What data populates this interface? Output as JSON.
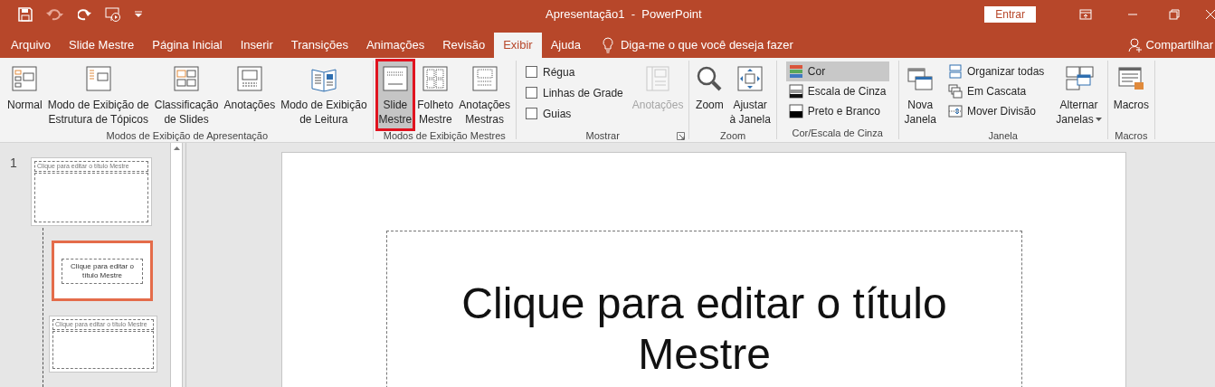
{
  "window": {
    "title": "Apresentação1  -  PowerPoint",
    "sign_in": "Entrar"
  },
  "tabs": [
    {
      "label": "Arquivo",
      "selected": false
    },
    {
      "label": "Slide Mestre",
      "selected": false
    },
    {
      "label": "Página Inicial",
      "selected": false
    },
    {
      "label": "Inserir",
      "selected": false
    },
    {
      "label": "Transições",
      "selected": false
    },
    {
      "label": "Animações",
      "selected": false
    },
    {
      "label": "Revisão",
      "selected": false
    },
    {
      "label": "Exibir",
      "selected": true
    },
    {
      "label": "Ajuda",
      "selected": false
    }
  ],
  "tell_me": "Diga-me o que você deseja fazer",
  "share": "Compartilhar",
  "ribbon": [
    {
      "label": "Modos de Exibição de Apresentação",
      "controls": [
        {
          "kind": "large",
          "lines": [
            "Normal"
          ]
        },
        {
          "kind": "large",
          "lines": [
            "Modo de Exibição de",
            "Estrutura de Tópicos"
          ]
        },
        {
          "kind": "large",
          "lines": [
            "Classificação",
            "de Slides"
          ]
        },
        {
          "kind": "large",
          "lines": [
            "Anotações"
          ]
        },
        {
          "kind": "large",
          "lines": [
            "Modo de Exibição",
            "de Leitura"
          ]
        }
      ]
    },
    {
      "label": "Modos de Exibição Mestres",
      "controls": [
        {
          "kind": "large",
          "lines": [
            "Slide",
            "Mestre"
          ],
          "selected": true
        },
        {
          "kind": "large",
          "lines": [
            "Folheto",
            "Mestre"
          ],
          "selected": false
        },
        {
          "kind": "large",
          "lines": [
            "Anotações",
            "Mestras"
          ],
          "selected": false
        }
      ]
    },
    {
      "label": "Mostrar",
      "launcher": true,
      "controls": [
        {
          "kind": "check",
          "lines": [
            "Régua"
          ],
          "checked": false
        },
        {
          "kind": "check",
          "lines": [
            "Linhas de Grade"
          ],
          "checked": false
        },
        {
          "kind": "check",
          "lines": [
            "Guias"
          ],
          "checked": false
        },
        {
          "kind": "large",
          "lines": [
            "Anotações"
          ],
          "disabled": true
        }
      ]
    },
    {
      "label": "Zoom",
      "controls": [
        {
          "kind": "large",
          "lines": [
            "Zoom"
          ]
        },
        {
          "kind": "large",
          "lines": [
            "Ajustar",
            "à Janela"
          ]
        }
      ]
    },
    {
      "label": "Cor/Escala de Cinza",
      "controls": [
        {
          "kind": "small",
          "lines": [
            "Cor"
          ],
          "selected": true
        },
        {
          "kind": "small",
          "lines": [
            "Escala de Cinza"
          ],
          "selected": false
        },
        {
          "kind": "small",
          "lines": [
            "Preto e Branco"
          ],
          "selected": false
        }
      ]
    },
    {
      "label": "Janela",
      "controls": [
        {
          "kind": "large",
          "lines": [
            "Nova",
            "Janela"
          ]
        },
        {
          "kind": "small",
          "lines": [
            "Organizar todas"
          ]
        },
        {
          "kind": "small",
          "lines": [
            "Em Cascata"
          ]
        },
        {
          "kind": "small",
          "lines": [
            "Mover Divisão"
          ]
        },
        {
          "kind": "large",
          "lines": [
            "Alternar",
            "Janelas"
          ],
          "dropdown": true
        }
      ]
    },
    {
      "label": "Macros",
      "controls": [
        {
          "kind": "large",
          "lines": [
            "Macros"
          ]
        }
      ]
    }
  ],
  "thumbnails": [
    {
      "number": "1",
      "title": "Clique para editar o título Mestre",
      "selected": false
    },
    {
      "title": "Clique para editar o título Mestre",
      "selected": true
    },
    {
      "title": "Clique para editar o título Mestre",
      "selected": false
    }
  ],
  "slide": {
    "title": "Clique para editar o título Mestre"
  }
}
